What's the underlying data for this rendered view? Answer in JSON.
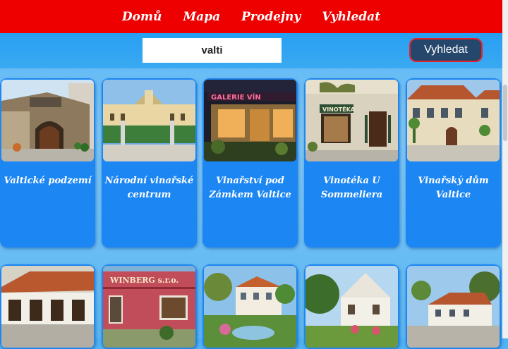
{
  "nav": {
    "items": [
      {
        "label": "Domů"
      },
      {
        "label": "Mapa"
      },
      {
        "label": "Prodejny"
      },
      {
        "label": "Vyhledat"
      }
    ]
  },
  "search": {
    "value": "valti",
    "button_label": "Vyhledat"
  },
  "cards": [
    {
      "title": "Valtické podzemí"
    },
    {
      "title": "Národní vinařské centrum"
    },
    {
      "title": "Vinařství pod Zámkem Valtice"
    },
    {
      "title": "Vinotéka U Sommeliera"
    },
    {
      "title": "Vinařský dům Valtice"
    },
    {
      "title": ""
    },
    {
      "title": ""
    },
    {
      "title": ""
    },
    {
      "title": ""
    },
    {
      "title": ""
    }
  ],
  "photo_signs": {
    "card3": "GALERIE VÍN",
    "card4": "VINOTÉKA",
    "card7": "WINBERG s.r.o."
  }
}
